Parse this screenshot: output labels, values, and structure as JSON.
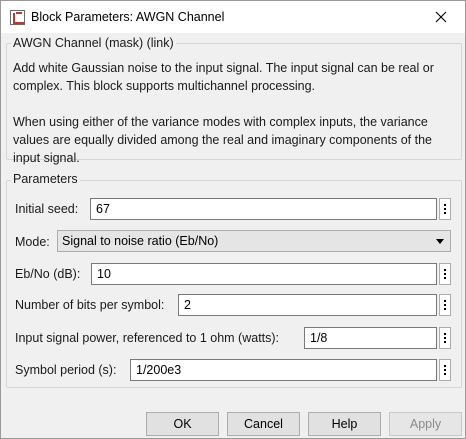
{
  "window": {
    "title": "Block Parameters: AWGN Channel",
    "close_label": "×"
  },
  "description_group": {
    "legend": "AWGN Channel (mask) (link)",
    "para1_line1": "Add white Gaussian noise to the input signal. The input signal can be real or",
    "para1_line2": "complex. This block supports multichannel processing.",
    "para2_line1": "When using either of the variance modes with complex inputs, the variance",
    "para2_line2": "values are equally divided among the real and imaginary components of the",
    "para2_line3": "input signal."
  },
  "parameters": {
    "legend": "Parameters",
    "initial_seed": {
      "label": "Initial seed:",
      "value": "67"
    },
    "mode": {
      "label": "Mode:",
      "value": "Signal to noise ratio  (Eb/No)"
    },
    "ebno": {
      "label": "Eb/No (dB):",
      "value": "10"
    },
    "bits_per_symbol": {
      "label": "Number of bits per symbol:",
      "value": "2"
    },
    "input_power": {
      "label": "Input signal power, referenced to 1 ohm (watts):",
      "value": "1/8"
    },
    "symbol_period": {
      "label": "Symbol period (s):",
      "value": "1/200e3"
    }
  },
  "buttons": {
    "ok": "OK",
    "cancel": "Cancel",
    "help": "Help",
    "apply": "Apply"
  },
  "icons": {
    "app": "block-parameters-icon",
    "close": "close-icon",
    "more": "vertical-ellipsis-icon",
    "dropdown": "chevron-down-icon"
  }
}
